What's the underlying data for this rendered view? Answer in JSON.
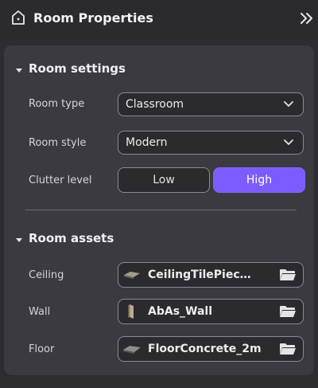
{
  "header": {
    "title": "Room Properties",
    "icon": "home-icon",
    "collapse_icon": "double-chevron-right-icon"
  },
  "room_settings": {
    "title": "Room settings",
    "room_type": {
      "label": "Room type",
      "value": "Classroom"
    },
    "room_style": {
      "label": "Room style",
      "value": "Modern"
    },
    "clutter_level": {
      "label": "Clutter level",
      "options": [
        "Low",
        "High"
      ],
      "selected": "High"
    }
  },
  "room_assets": {
    "title": "Room assets",
    "items": [
      {
        "label": "Ceiling",
        "value": "CeilingTilePiec…",
        "thumb": "ceiling-tile-thumbnail-icon"
      },
      {
        "label": "Wall",
        "value": "AbAs_Wall",
        "thumb": "wall-thumbnail-icon"
      },
      {
        "label": "Floor",
        "value": "FloorConcrete_2m",
        "thumb": "floor-concrete-thumbnail-icon"
      }
    ]
  },
  "colors": {
    "accent": "#7c5cff",
    "panel_bg": "#3a3a40",
    "window_bg": "#2c2c31"
  }
}
